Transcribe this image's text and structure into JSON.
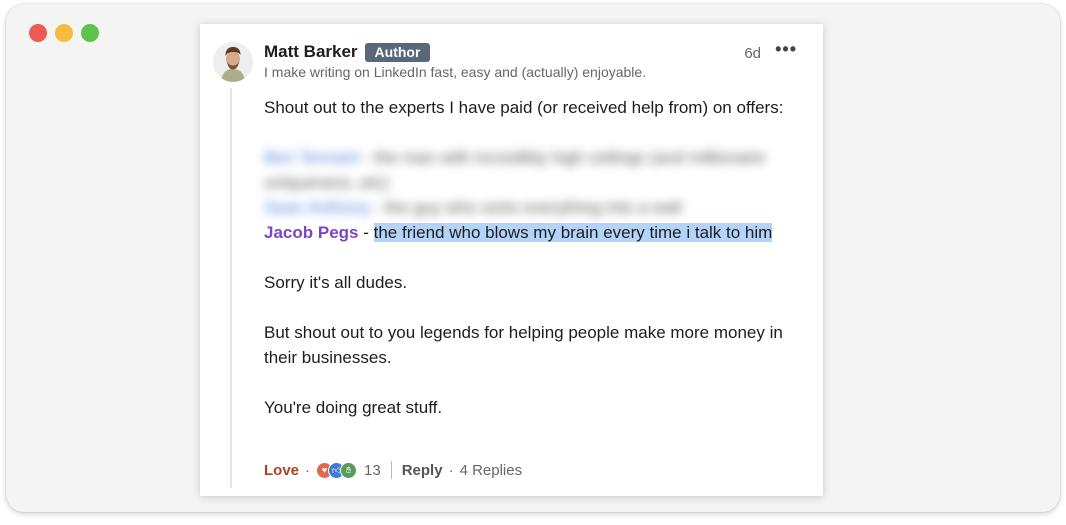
{
  "comment": {
    "author_name": "Matt Barker",
    "author_badge": "Author",
    "headline": "I make writing on LinkedIn fast, easy and (actually) enjoyable.",
    "time": "6d",
    "more_icon": "more-horizontal-icon",
    "body": {
      "intro": "Shout out to the experts I have paid (or received help from) on offers:",
      "blurred_1_name": "Ben Tennant",
      "blurred_1_text": " - the man with incredibly high ceilings (and millionaire uniqueness..etc)",
      "blurred_2_name": "Sean Anthony",
      "blurred_2_text": " - the guy who sorts everything into a wall",
      "mention_name": "Jacob Pegs",
      "mention_sep": " - ",
      "mention_text": "the friend who blows my brain every time i talk to him",
      "line_sorry": "Sorry it's all dudes.",
      "line_thanks": "But shout out to you legends for helping people make more money in their businesses.",
      "line_great": "You're doing great stuff."
    },
    "footer": {
      "reaction_label": "Love",
      "dot": "·",
      "reaction_count": "13",
      "reply_label": "Reply",
      "replies_count": "4 Replies"
    },
    "colors": {
      "mention": "#7b46c2",
      "highlight": "#b4d3f8",
      "love": "#b24020",
      "badge_bg": "#56687a"
    }
  }
}
